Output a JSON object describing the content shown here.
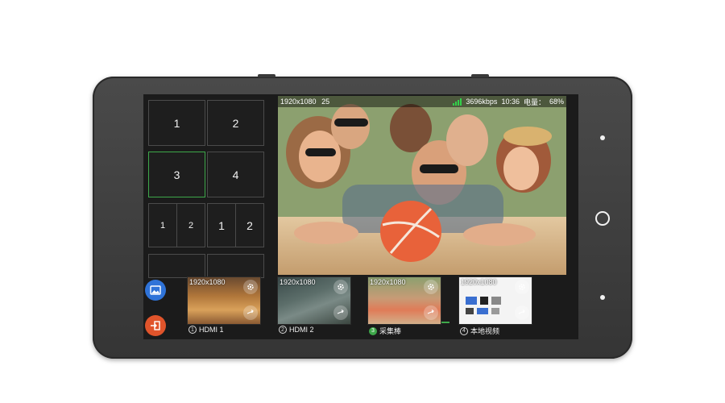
{
  "device": {
    "screen": {
      "layout_grid": {
        "cells": [
          "1",
          "2",
          "3",
          "4"
        ],
        "split_cell_a": [
          "1",
          "2"
        ],
        "split_cell_b": [
          "1",
          "2"
        ],
        "selected": "3"
      },
      "preview": {
        "resolution": "1920x1080",
        "fps": "25",
        "bitrate": "3696kbps",
        "time": "10:36",
        "battery_label": "电量：",
        "battery_value": "68%"
      },
      "sources": [
        {
          "index": "1",
          "resolution": "1920x1080",
          "label": "HDMI 1",
          "active": false
        },
        {
          "index": "2",
          "resolution": "1920x1080",
          "label": "HDMI 2",
          "active": false
        },
        {
          "index": "3",
          "resolution": "1920x1080",
          "label": "采集棒",
          "active": true
        },
        {
          "index": "4",
          "resolution": "1920x1080",
          "label": "本地视频",
          "active": false
        }
      ],
      "icons": {
        "gallery": "gallery-icon",
        "exit": "exit-icon",
        "settings": "gear-icon",
        "swap": "swap-icon"
      }
    }
  },
  "colors": {
    "accent_green": "#3ea84a",
    "gallery_blue": "#2f73d8",
    "exit_orange": "#e0542b"
  }
}
